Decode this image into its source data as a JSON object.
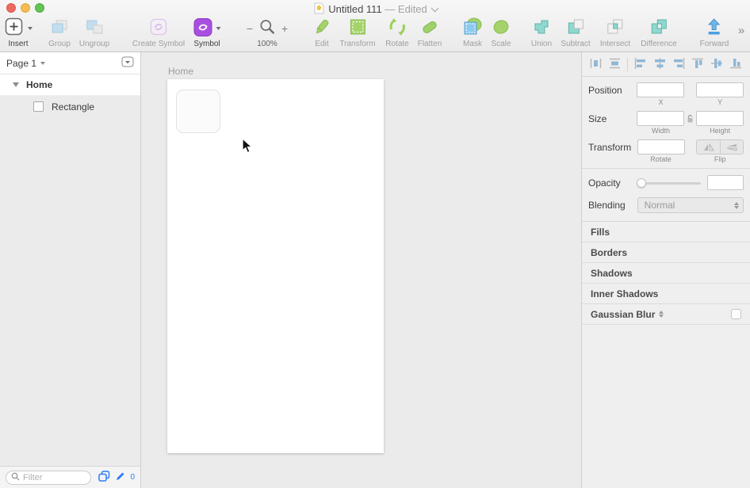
{
  "window": {
    "title": "Untitled 111",
    "edited": "— Edited"
  },
  "toolbar": {
    "insert": "Insert",
    "group": "Group",
    "ungroup": "Ungroup",
    "create_symbol": "Create Symbol",
    "symbol": "Symbol",
    "zoom_out": "−",
    "zoom_in": "+",
    "zoom_level": "100%",
    "edit": "Edit",
    "transform": "Transform",
    "rotate": "Rotate",
    "flatten": "Flatten",
    "mask": "Mask",
    "scale": "Scale",
    "union": "Union",
    "subtract": "Subtract",
    "intersect": "Intersect",
    "difference": "Difference",
    "forward": "Forward",
    "overflow": "»"
  },
  "sidebar": {
    "page_selector": "Page 1",
    "layers": [
      {
        "name": "Home",
        "type": "artboard"
      },
      {
        "name": "Rectangle",
        "type": "rectangle"
      }
    ],
    "filter_placeholder": "Filter",
    "badge_count": "0"
  },
  "canvas": {
    "artboard_name": "Home"
  },
  "inspector": {
    "position_label": "Position",
    "x_label": "X",
    "y_label": "Y",
    "size_label": "Size",
    "width_label": "Width",
    "height_label": "Height",
    "transform_label": "Transform",
    "rotate_label": "Rotate",
    "flip_label": "Flip",
    "opacity_label": "Opacity",
    "blending_label": "Blending",
    "blending_value": "Normal",
    "sections": [
      "Fills",
      "Borders",
      "Shadows",
      "Inner Shadows"
    ],
    "gaussian_blur_label": "Gaussian Blur"
  },
  "colors": {
    "tool_green": "#a4d36a",
    "tool_teal": "#8fd8cf",
    "tool_blue": "#7fc3ea",
    "symbol_purple": "#a94fe0",
    "accent_blue": "#2e7bf6"
  }
}
